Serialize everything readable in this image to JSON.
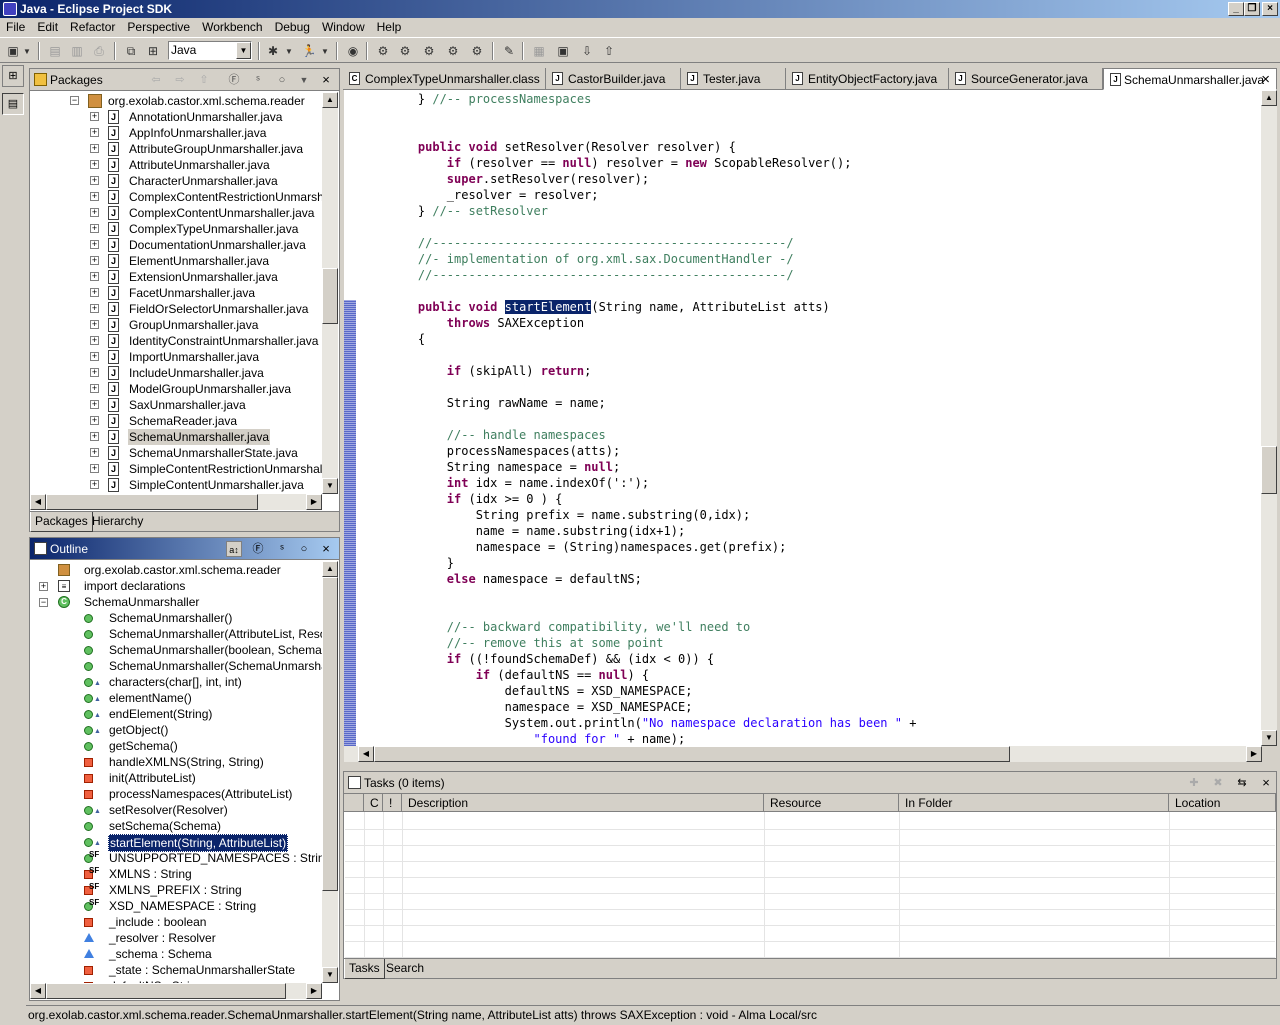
{
  "window": {
    "title": "Java - Eclipse Project SDK"
  },
  "menu": [
    "File",
    "Edit",
    "Refactor",
    "Perspective",
    "Workbench",
    "Debug",
    "Window",
    "Help"
  ],
  "toolbar": {
    "perspective_value": "Java"
  },
  "packages_view": {
    "title": "Packages",
    "root": "org.exolab.castor.xml.schema.reader",
    "files": [
      "AnnotationUnmarshaller.java",
      "AppInfoUnmarshaller.java",
      "AttributeGroupUnmarshaller.java",
      "AttributeUnmarshaller.java",
      "CharacterUnmarshaller.java",
      "ComplexContentRestrictionUnmarshaller.j",
      "ComplexContentUnmarshaller.java",
      "ComplexTypeUnmarshaller.java",
      "DocumentationUnmarshaller.java",
      "ElementUnmarshaller.java",
      "ExtensionUnmarshaller.java",
      "FacetUnmarshaller.java",
      "FieldOrSelectorUnmarshaller.java",
      "GroupUnmarshaller.java",
      "IdentityConstraintUnmarshaller.java",
      "ImportUnmarshaller.java",
      "IncludeUnmarshaller.java",
      "ModelGroupUnmarshaller.java",
      "SaxUnmarshaller.java",
      "SchemaReader.java",
      "SchemaUnmarshaller.java",
      "SchemaUnmarshallerState.java",
      "SimpleContentRestrictionUnmarshaller.jav",
      "SimpleContentUnmarshaller.java"
    ],
    "selected_file": "SchemaUnmarshaller.java",
    "tabs": [
      "Packages",
      "Hierarchy"
    ]
  },
  "outline_view": {
    "title": "Outline",
    "items": [
      {
        "label": "org.exolab.castor.xml.schema.reader",
        "icon": "package-icon"
      },
      {
        "label": "import declarations",
        "icon": "imports-icon"
      },
      {
        "label": "SchemaUnmarshaller",
        "icon": "class-icon"
      },
      {
        "label": "SchemaUnmarshaller()",
        "icon": "public-method-icon"
      },
      {
        "label": "SchemaUnmarshaller(AttributeList, Resolver)",
        "icon": "public-method-icon"
      },
      {
        "label": "SchemaUnmarshaller(boolean, SchemaUnma",
        "icon": "public-method-icon"
      },
      {
        "label": "SchemaUnmarshaller(SchemaUnmarshallerSt",
        "icon": "public-method-icon"
      },
      {
        "label": "characters(char[], int, int)",
        "icon": "override-method-icon"
      },
      {
        "label": "elementName()",
        "icon": "override-method-icon"
      },
      {
        "label": "endElement(String)",
        "icon": "override-method-icon"
      },
      {
        "label": "getObject()",
        "icon": "override-method-icon"
      },
      {
        "label": "getSchema()",
        "icon": "public-method-icon"
      },
      {
        "label": "handleXMLNS(String, String)",
        "icon": "private-method-icon"
      },
      {
        "label": "init(AttributeList)",
        "icon": "private-method-icon"
      },
      {
        "label": "processNamespaces(AttributeList)",
        "icon": "private-method-icon"
      },
      {
        "label": "setResolver(Resolver)",
        "icon": "override-method-icon"
      },
      {
        "label": "setSchema(Schema)",
        "icon": "public-method-icon"
      },
      {
        "label": "startElement(String, AttributeList)",
        "icon": "override-method-icon"
      },
      {
        "label": "UNSUPPORTED_NAMESPACES : String[]",
        "icon": "static-final-field-icon"
      },
      {
        "label": "XMLNS : String",
        "icon": "static-final-private-field-icon"
      },
      {
        "label": "XMLNS_PREFIX : String",
        "icon": "static-final-private-field-icon"
      },
      {
        "label": "XSD_NAMESPACE : String",
        "icon": "static-final-field-icon"
      },
      {
        "label": "_include : boolean",
        "icon": "private-field-icon"
      },
      {
        "label": "_resolver : Resolver",
        "icon": "protected-field-icon"
      },
      {
        "label": "_schema : Schema",
        "icon": "protected-field-icon"
      },
      {
        "label": "_state : SchemaUnmarshallerState",
        "icon": "private-field-icon"
      },
      {
        "label": "defaultNS : String",
        "icon": "private-field-icon"
      }
    ],
    "selected": "startElement(String, AttributeList)"
  },
  "editor": {
    "tabs": [
      "ComplexTypeUnmarshaller.class",
      "CastorBuilder.java",
      "Tester.java",
      "EntityObjectFactory.java",
      "SourceGenerator.java",
      "SchemaUnmarshaller.java"
    ],
    "active_tab": "SchemaUnmarshaller.java",
    "code_lines": [
      "    } //-- processNamespaces",
      "",
      "",
      "    public void setResolver(Resolver resolver) {",
      "        if (resolver == null) resolver = new ScopableResolver();",
      "        super.setResolver(resolver);",
      "        _resolver = resolver;",
      "    } //-- setResolver",
      "",
      "    //-------------------------------------------------/",
      "    //- implementation of org.xml.sax.DocumentHandler -/",
      "    //-------------------------------------------------/",
      "",
      "    public void startElement(String name, AttributeList atts)",
      "        throws SAXException",
      "    {",
      "",
      "        if (skipAll) return;",
      "",
      "        String rawName = name;",
      "",
      "        //-- handle namespaces",
      "        processNamespaces(atts);",
      "        String namespace = null;",
      "        int idx = name.indexOf(':');",
      "        if (idx >= 0 ) {",
      "            String prefix = name.substring(0,idx);",
      "            name = name.substring(idx+1);",
      "            namespace = (String)namespaces.get(prefix);",
      "        }",
      "        else namespace = defaultNS;",
      "",
      "",
      "        //-- backward compatibility, we'll need to",
      "        //-- remove this at some point",
      "        if ((!foundSchemaDef) && (idx < 0)) {",
      "            if (defaultNS == null) {",
      "                defaultNS = XSD_NAMESPACE;",
      "                namespace = XSD_NAMESPACE;",
      "                System.out.println(\"No namespace declaration has been \" +",
      "                    \"found for \" + name);"
    ],
    "highlighted_word": "startElement"
  },
  "tasks_view": {
    "title": "Tasks (0 items)",
    "columns": [
      "C",
      "!",
      "Description",
      "Resource",
      "In Folder",
      "Location"
    ],
    "tabs": [
      "Tasks",
      "Search"
    ]
  },
  "status_bar": {
    "text": "org.exolab.castor.xml.schema.reader.SchemaUnmarshaller.startElement(String name, AttributeList atts) throws SAXException : void - Alma Local/src"
  },
  "colors": {
    "title_active": "#0a246a",
    "keyword": "#7f0055",
    "comment": "#3f7f5f",
    "string": "#2a00ff",
    "chrome": "#d4d0c8"
  }
}
